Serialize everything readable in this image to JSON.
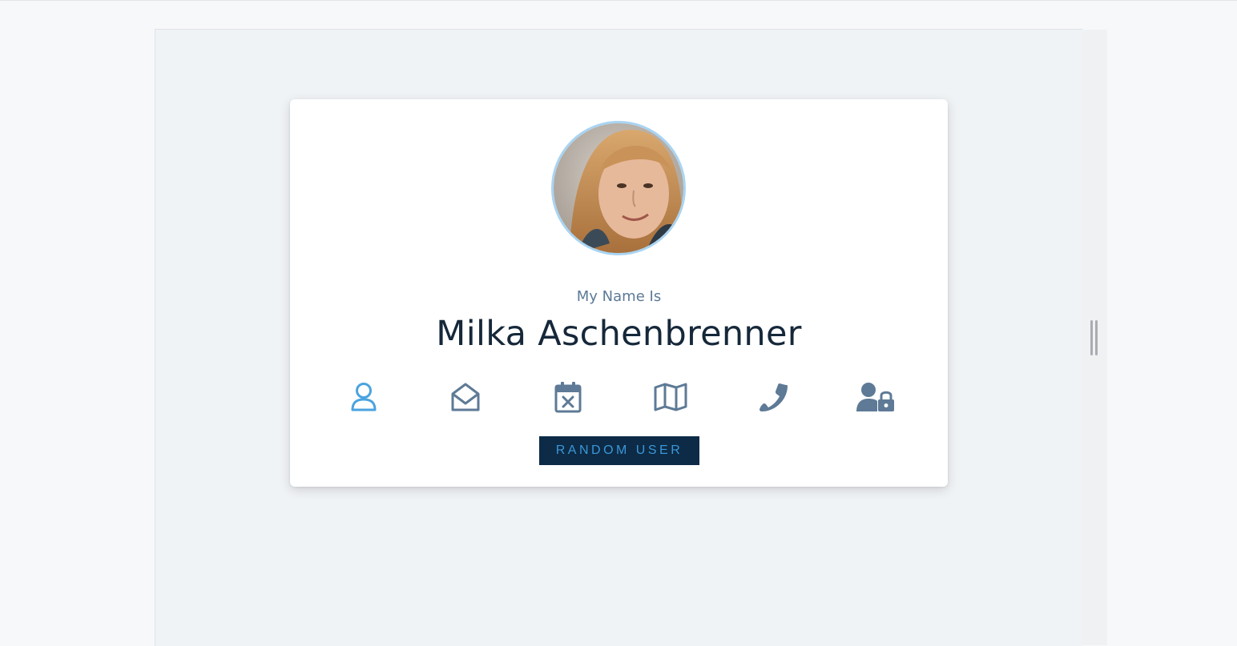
{
  "profile": {
    "label": "My Name Is",
    "value": "Milka Aschenbrenner"
  },
  "icons": [
    {
      "name": "user-icon",
      "active": true
    },
    {
      "name": "envelope-open-icon",
      "active": false
    },
    {
      "name": "calendar-x-icon",
      "active": false
    },
    {
      "name": "map-icon",
      "active": false
    },
    {
      "name": "phone-icon",
      "active": false
    },
    {
      "name": "user-lock-icon",
      "active": false
    }
  ],
  "actions": {
    "random_label": "RANDOM USER"
  },
  "colors": {
    "active_icon": "#4aa3df",
    "inactive_icon": "#5e7a96",
    "button_bg": "#0d2b46",
    "button_text": "#3a97d9",
    "avatar_ring": "#a9d4f2"
  }
}
